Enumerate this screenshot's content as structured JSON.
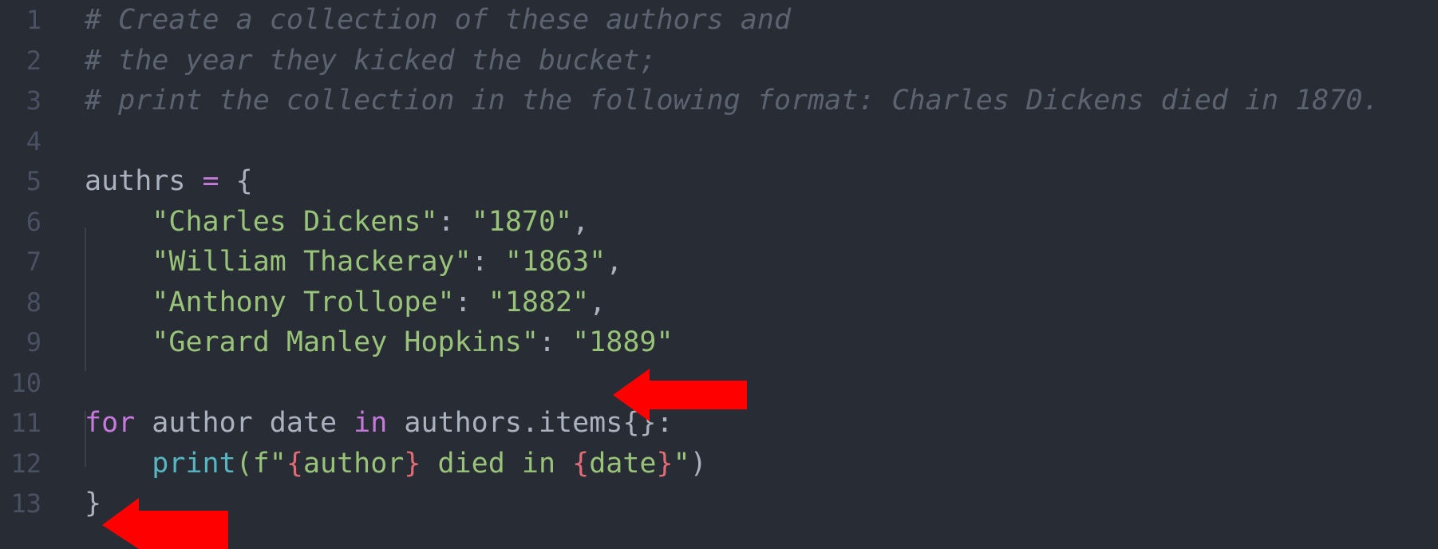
{
  "editor": {
    "lines": [
      {
        "num": "1",
        "tokens": [
          {
            "t": "# Create a collection of these authors and",
            "c": "comment"
          }
        ]
      },
      {
        "num": "2",
        "tokens": [
          {
            "t": "# the year they kicked the bucket;",
            "c": "comment"
          }
        ]
      },
      {
        "num": "3",
        "tokens": [
          {
            "t": "# print the collection in the following format: Charles Dickens died in 1870.",
            "c": "comment"
          }
        ]
      },
      {
        "num": "4",
        "tokens": []
      },
      {
        "num": "5",
        "tokens": [
          {
            "t": "authrs ",
            "c": "plain"
          },
          {
            "t": "=",
            "c": "op"
          },
          {
            "t": " {",
            "c": "punc"
          }
        ]
      },
      {
        "num": "6",
        "tokens": [
          {
            "t": "    ",
            "c": "plain"
          },
          {
            "t": "\"Charles Dickens\"",
            "c": "str"
          },
          {
            "t": ": ",
            "c": "punc"
          },
          {
            "t": "\"1870\"",
            "c": "str"
          },
          {
            "t": ",",
            "c": "punc"
          }
        ]
      },
      {
        "num": "7",
        "tokens": [
          {
            "t": "    ",
            "c": "plain"
          },
          {
            "t": "\"William Thackeray\"",
            "c": "str"
          },
          {
            "t": ": ",
            "c": "punc"
          },
          {
            "t": "\"1863\"",
            "c": "str"
          },
          {
            "t": ",",
            "c": "punc"
          }
        ]
      },
      {
        "num": "8",
        "tokens": [
          {
            "t": "    ",
            "c": "plain"
          },
          {
            "t": "\"Anthony Trollope\"",
            "c": "str"
          },
          {
            "t": ": ",
            "c": "punc"
          },
          {
            "t": "\"1882\"",
            "c": "str"
          },
          {
            "t": ",",
            "c": "punc"
          }
        ]
      },
      {
        "num": "9",
        "tokens": [
          {
            "t": "    ",
            "c": "plain"
          },
          {
            "t": "\"Gerard Manley Hopkins\"",
            "c": "str"
          },
          {
            "t": ": ",
            "c": "punc"
          },
          {
            "t": "\"1889\"",
            "c": "str"
          }
        ]
      },
      {
        "num": "10",
        "tokens": []
      },
      {
        "num": "11",
        "tokens": [
          {
            "t": "for",
            "c": "kw"
          },
          {
            "t": " author date ",
            "c": "plain"
          },
          {
            "t": "in",
            "c": "kw"
          },
          {
            "t": " authors.items{}:",
            "c": "plain"
          }
        ]
      },
      {
        "num": "12",
        "tokens": [
          {
            "t": "    ",
            "c": "plain"
          },
          {
            "t": "print",
            "c": "fn"
          },
          {
            "t": "(f\"",
            "c": "str"
          },
          {
            "t": "{",
            "c": "interp"
          },
          {
            "t": "author",
            "c": "str"
          },
          {
            "t": "}",
            "c": "interp"
          },
          {
            "t": " died in ",
            "c": "str"
          },
          {
            "t": "{",
            "c": "interp"
          },
          {
            "t": "date",
            "c": "str"
          },
          {
            "t": "}",
            "c": "interp"
          },
          {
            "t": "\"",
            "c": "str"
          },
          {
            "t": ")",
            "c": "punc"
          }
        ]
      },
      {
        "num": "13",
        "tokens": [
          {
            "t": "}",
            "c": "punc"
          }
        ]
      }
    ]
  },
  "colors": {
    "background": "#282c34",
    "arrow": "#ff0000"
  }
}
